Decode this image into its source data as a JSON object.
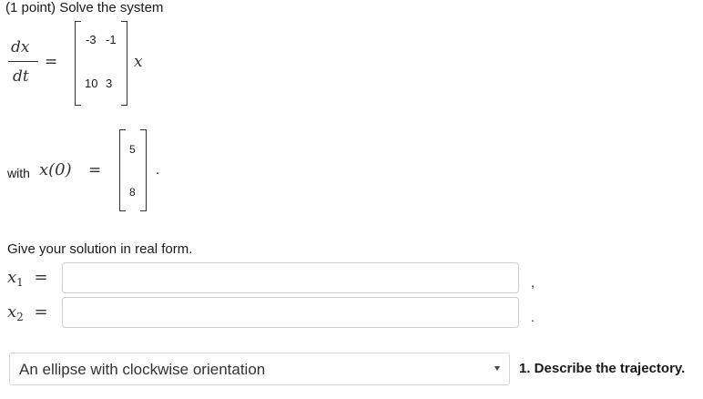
{
  "problem": {
    "header": "(1 point) Solve the system",
    "derivative": {
      "numerator": "dx",
      "denominator": "dt",
      "equals": "="
    },
    "matrix": {
      "rows": [
        [
          "-3",
          "-1"
        ],
        [
          "10",
          "3"
        ]
      ]
    },
    "times_var": "x",
    "initial": {
      "with_label": "with",
      "expr": "x(0)",
      "equals": "=",
      "vector": [
        "5",
        "8"
      ],
      "period": "."
    },
    "instruction": "Give your solution in real form."
  },
  "answers": {
    "x1_label": "x",
    "x1_sub": "1",
    "x2_label": "x",
    "x2_sub": "2",
    "equals": "=",
    "x1_value": "",
    "x2_value": "",
    "sep1": ",",
    "sep2": "."
  },
  "trajectory": {
    "selected": "An ellipse with clockwise orientation",
    "question": "1. Describe the trajectory."
  }
}
